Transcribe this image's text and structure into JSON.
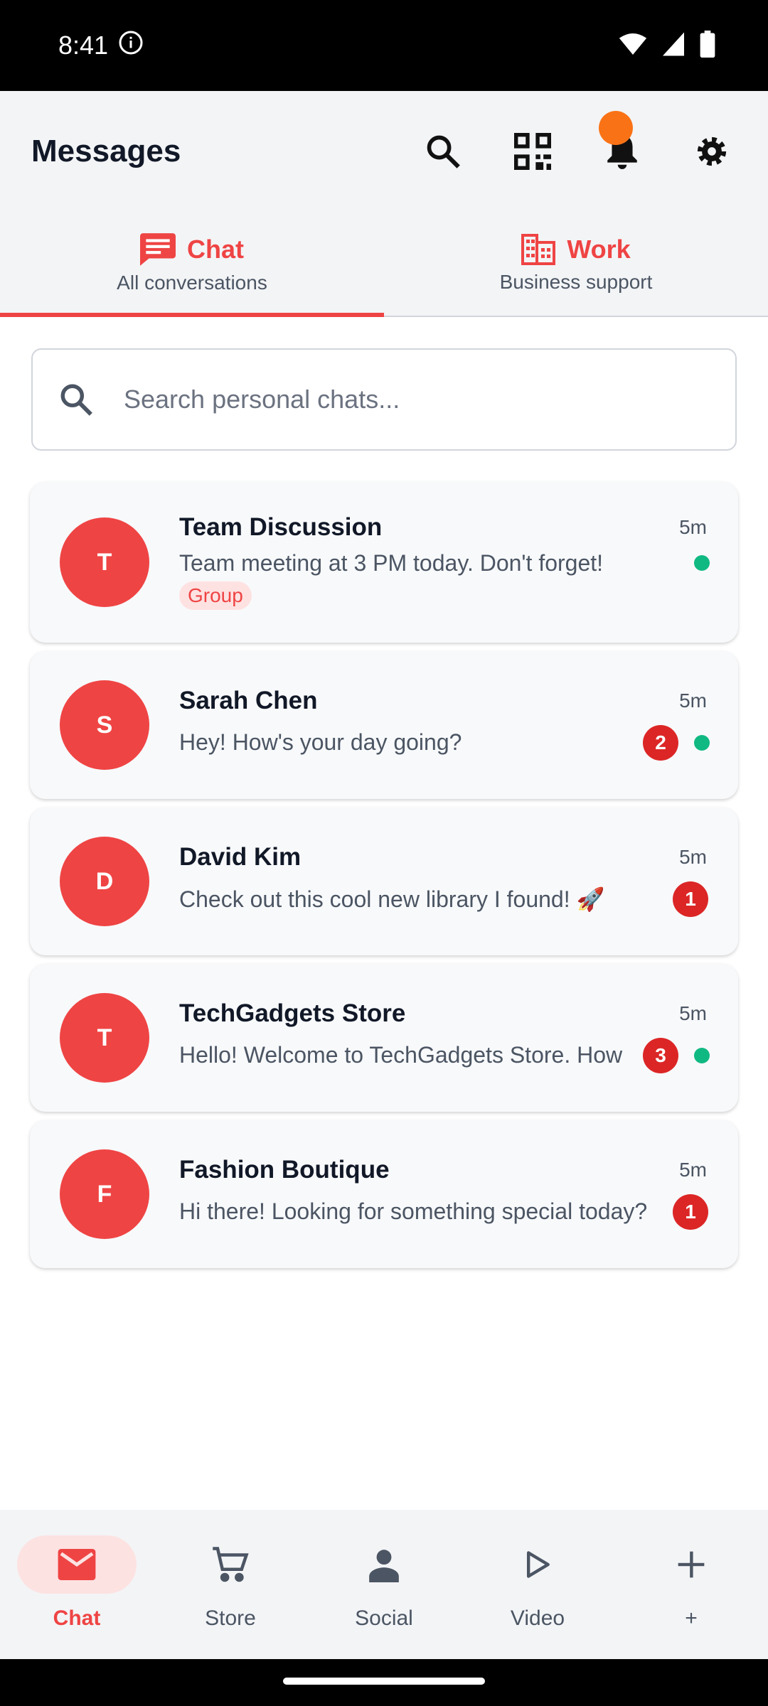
{
  "status_bar": {
    "time": "8:41"
  },
  "header": {
    "title": "Messages"
  },
  "tabs": [
    {
      "label": "Chat",
      "subtitle": "All conversations"
    },
    {
      "label": "Work",
      "subtitle": "Business support"
    }
  ],
  "search": {
    "placeholder": "Search personal chats..."
  },
  "chats": [
    {
      "avatar": "T",
      "name": "Team Discussion",
      "time": "5m",
      "preview": "Team meeting at 3 PM today. Don't forget!",
      "tag": "Group",
      "unread": null,
      "online": true
    },
    {
      "avatar": "S",
      "name": "Sarah Chen",
      "time": "5m",
      "preview": "Hey! How's your day going?",
      "tag": null,
      "unread": "2",
      "online": true
    },
    {
      "avatar": "D",
      "name": "David Kim",
      "time": "5m",
      "preview": "Check out this cool new library I found! 🚀",
      "tag": null,
      "unread": "1",
      "online": false
    },
    {
      "avatar": "T",
      "name": "TechGadgets Store",
      "time": "5m",
      "preview": "Hello! Welcome to TechGadgets Store. How",
      "tag": null,
      "unread": "3",
      "online": true
    },
    {
      "avatar": "F",
      "name": "Fashion Boutique",
      "time": "5m",
      "preview": "Hi there! Looking for something special today?",
      "tag": null,
      "unread": "1",
      "online": false
    }
  ],
  "bottom_nav": [
    {
      "label": "Chat",
      "icon": "mail-icon"
    },
    {
      "label": "Store",
      "icon": "cart-icon"
    },
    {
      "label": "Social",
      "icon": "person-icon"
    },
    {
      "label": "Video",
      "icon": "play-icon"
    },
    {
      "label": "+",
      "icon": "plus-icon"
    }
  ],
  "colors": {
    "accent": "#ef4444",
    "online": "#10b981",
    "notification": "#f97316"
  }
}
